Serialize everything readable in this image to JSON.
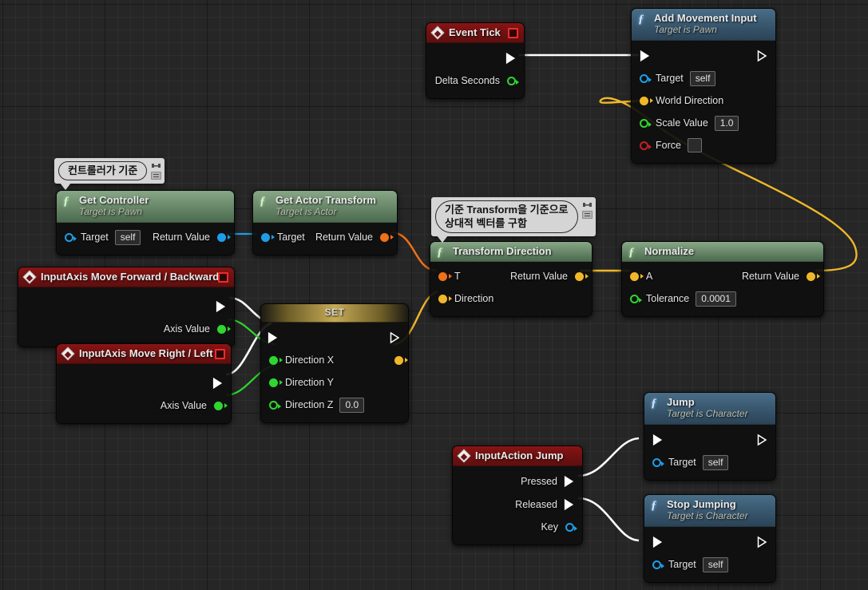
{
  "app": {
    "editor": "Unreal Engine Blueprint Event Graph",
    "background_color": "#262626",
    "grid_color": "#2f2f2f"
  },
  "comments": [
    {
      "id": "comment-controller",
      "text": "컨트롤러가 기준",
      "pin_icon": "pin-icon",
      "toggle_icon": "bubble-toggle-icon"
    },
    {
      "id": "comment-transform",
      "text": "기준 Transform을 기준으로\n상대적 벡터를 구함",
      "pin_icon": "pin-icon",
      "toggle_icon": "bubble-toggle-icon"
    }
  ],
  "nodes": {
    "event_tick": {
      "title": "Event Tick",
      "icon": "event-diamond-icon",
      "stop_icon": "stop-recording-icon",
      "header_color": "#7a1212",
      "exec_out": "exec-output",
      "pins": [
        {
          "label": "Delta Seconds",
          "type": "float",
          "color": "#2fd62f",
          "style": "hollow",
          "side": "output"
        }
      ]
    },
    "add_movement_input": {
      "title": "Add Movement Input",
      "subtitle": "Target is Pawn",
      "icon": "function-f-icon",
      "header_color": "#3c5c74",
      "pins": [
        {
          "label": "Target",
          "value": "self",
          "type": "object",
          "color": "#1e9ee8",
          "style": "hollow",
          "side": "input"
        },
        {
          "label": "World Direction",
          "type": "vector",
          "color": "#f0b829",
          "style": "filled",
          "side": "input"
        },
        {
          "label": "Scale Value",
          "value": "1.0",
          "type": "float",
          "color": "#2fd62f",
          "style": "hollow",
          "side": "input"
        },
        {
          "label": "Force",
          "value": "",
          "type": "bool",
          "color": "#c32020",
          "style": "hollow",
          "side": "input"
        }
      ]
    },
    "get_controller": {
      "title": "Get Controller",
      "subtitle": "Target is Pawn",
      "icon": "function-f-icon",
      "header_color": "#6d8c6d",
      "pins": [
        {
          "label": "Target",
          "value": "self",
          "type": "object",
          "color": "#1e9ee8",
          "style": "hollow",
          "side": "input"
        },
        {
          "label": "Return Value",
          "type": "object",
          "color": "#1e9ee8",
          "style": "filled",
          "side": "output"
        }
      ]
    },
    "get_actor_transform": {
      "title": "Get Actor Transform",
      "subtitle": "Target is Actor",
      "icon": "function-f-icon",
      "header_color": "#6d8c6d",
      "pins": [
        {
          "label": "Target",
          "type": "object",
          "color": "#1e9ee8",
          "style": "filled",
          "side": "input"
        },
        {
          "label": "Return Value",
          "type": "transform",
          "color": "#f07117",
          "style": "filled",
          "side": "output"
        }
      ]
    },
    "transform_direction": {
      "title": "Transform Direction",
      "icon": "function-f-icon",
      "header_color": "#6d8c6d",
      "pins": [
        {
          "label": "T",
          "type": "transform",
          "color": "#f07117",
          "style": "filled",
          "side": "input"
        },
        {
          "label": "Direction",
          "type": "vector",
          "color": "#f0b829",
          "style": "filled",
          "side": "input"
        },
        {
          "label": "Return Value",
          "type": "vector",
          "color": "#f0b829",
          "style": "filled",
          "side": "output"
        }
      ]
    },
    "normalize": {
      "title": "Normalize",
      "icon": "function-f-icon",
      "header_color": "#6d8c6d",
      "pins": [
        {
          "label": "A",
          "type": "vector",
          "color": "#f0b829",
          "style": "filled",
          "side": "input"
        },
        {
          "label": "Tolerance",
          "value": "0.0001",
          "type": "float",
          "color": "#2fd62f",
          "style": "hollow",
          "side": "input"
        },
        {
          "label": "Return Value",
          "type": "vector",
          "color": "#f0b829",
          "style": "filled",
          "side": "output"
        }
      ]
    },
    "input_axis_forward": {
      "title": "InputAxis Move Forward / Backward",
      "icon": "event-diamond-icon",
      "stop_icon": "stop-recording-icon",
      "header_color": "#7a1212",
      "pins": [
        {
          "label": "Axis Value",
          "type": "float",
          "color": "#2fd62f",
          "style": "filled",
          "side": "output"
        }
      ]
    },
    "input_axis_right": {
      "title": "InputAxis Move Right / Left",
      "icon": "event-diamond-icon",
      "stop_icon": "stop-recording-icon",
      "header_color": "#7a1212",
      "pins": [
        {
          "label": "Axis Value",
          "type": "float",
          "color": "#2fd62f",
          "style": "filled",
          "side": "output"
        }
      ]
    },
    "set_direction": {
      "title": "SET",
      "header_color": "#c6aa56",
      "pins": [
        {
          "label": "Direction  X",
          "type": "float",
          "color": "#2fd62f",
          "style": "filled",
          "side": "input"
        },
        {
          "label": "Direction  Y",
          "type": "float",
          "color": "#2fd62f",
          "style": "filled",
          "side": "input"
        },
        {
          "label": "Direction  Z",
          "value": "0.0",
          "type": "float",
          "color": "#2fd62f",
          "style": "hollow",
          "side": "input"
        },
        {
          "label": "",
          "type": "vector",
          "color": "#f0b829",
          "style": "filled",
          "side": "output"
        }
      ]
    },
    "input_action_jump": {
      "title": "InputAction Jump",
      "icon": "event-diamond-icon",
      "header_color": "#7a1212",
      "pins": [
        {
          "label": "Pressed",
          "type": "exec",
          "side": "output"
        },
        {
          "label": "Released",
          "type": "exec",
          "side": "output"
        },
        {
          "label": "Key",
          "type": "struct",
          "color": "#1e9ee8",
          "style": "hollow",
          "side": "output"
        }
      ]
    },
    "jump": {
      "title": "Jump",
      "subtitle": "Target is Character",
      "icon": "function-f-icon",
      "header_color": "#3c5c74",
      "pins": [
        {
          "label": "Target",
          "value": "self",
          "type": "object",
          "color": "#1e9ee8",
          "style": "hollow",
          "side": "input"
        }
      ]
    },
    "stop_jumping": {
      "title": "Stop Jumping",
      "subtitle": "Target is Character",
      "icon": "function-f-icon",
      "header_color": "#3c5c74",
      "pins": [
        {
          "label": "Target",
          "value": "self",
          "type": "object",
          "color": "#1e9ee8",
          "style": "hollow",
          "side": "input"
        }
      ]
    }
  },
  "wires": [
    {
      "from": "event_tick.exec",
      "to": "add_movement_input.exec",
      "color": "#ffffff",
      "type": "exec"
    },
    {
      "from": "get_controller.return",
      "to": "get_actor_transform.target",
      "color": "#1e9ee8",
      "type": "data"
    },
    {
      "from": "get_actor_transform.return",
      "to": "transform_direction.t",
      "color": "#f07117",
      "type": "data"
    },
    {
      "from": "set_direction.out",
      "to": "transform_direction.direction",
      "color": "#f0b829",
      "type": "data"
    },
    {
      "from": "transform_direction.return",
      "to": "normalize.a",
      "color": "#f0b829",
      "type": "data"
    },
    {
      "from": "normalize.return",
      "to": "add_movement_input.world_direction",
      "color": "#f0b829",
      "type": "data"
    },
    {
      "from": "input_axis_forward.exec",
      "to": "set_direction.exec",
      "color": "#ffffff",
      "type": "exec"
    },
    {
      "from": "input_axis_right.exec",
      "to": "set_direction.exec",
      "color": "#ffffff",
      "type": "exec"
    },
    {
      "from": "input_axis_forward.axis_value",
      "to": "set_direction.x",
      "color": "#2fd62f",
      "type": "data"
    },
    {
      "from": "input_axis_right.axis_value",
      "to": "set_direction.y",
      "color": "#2fd62f",
      "type": "data"
    },
    {
      "from": "input_action_jump.pressed",
      "to": "jump.exec",
      "color": "#ffffff",
      "type": "exec"
    },
    {
      "from": "input_action_jump.released",
      "to": "stop_jumping.exec",
      "color": "#ffffff",
      "type": "exec"
    }
  ]
}
